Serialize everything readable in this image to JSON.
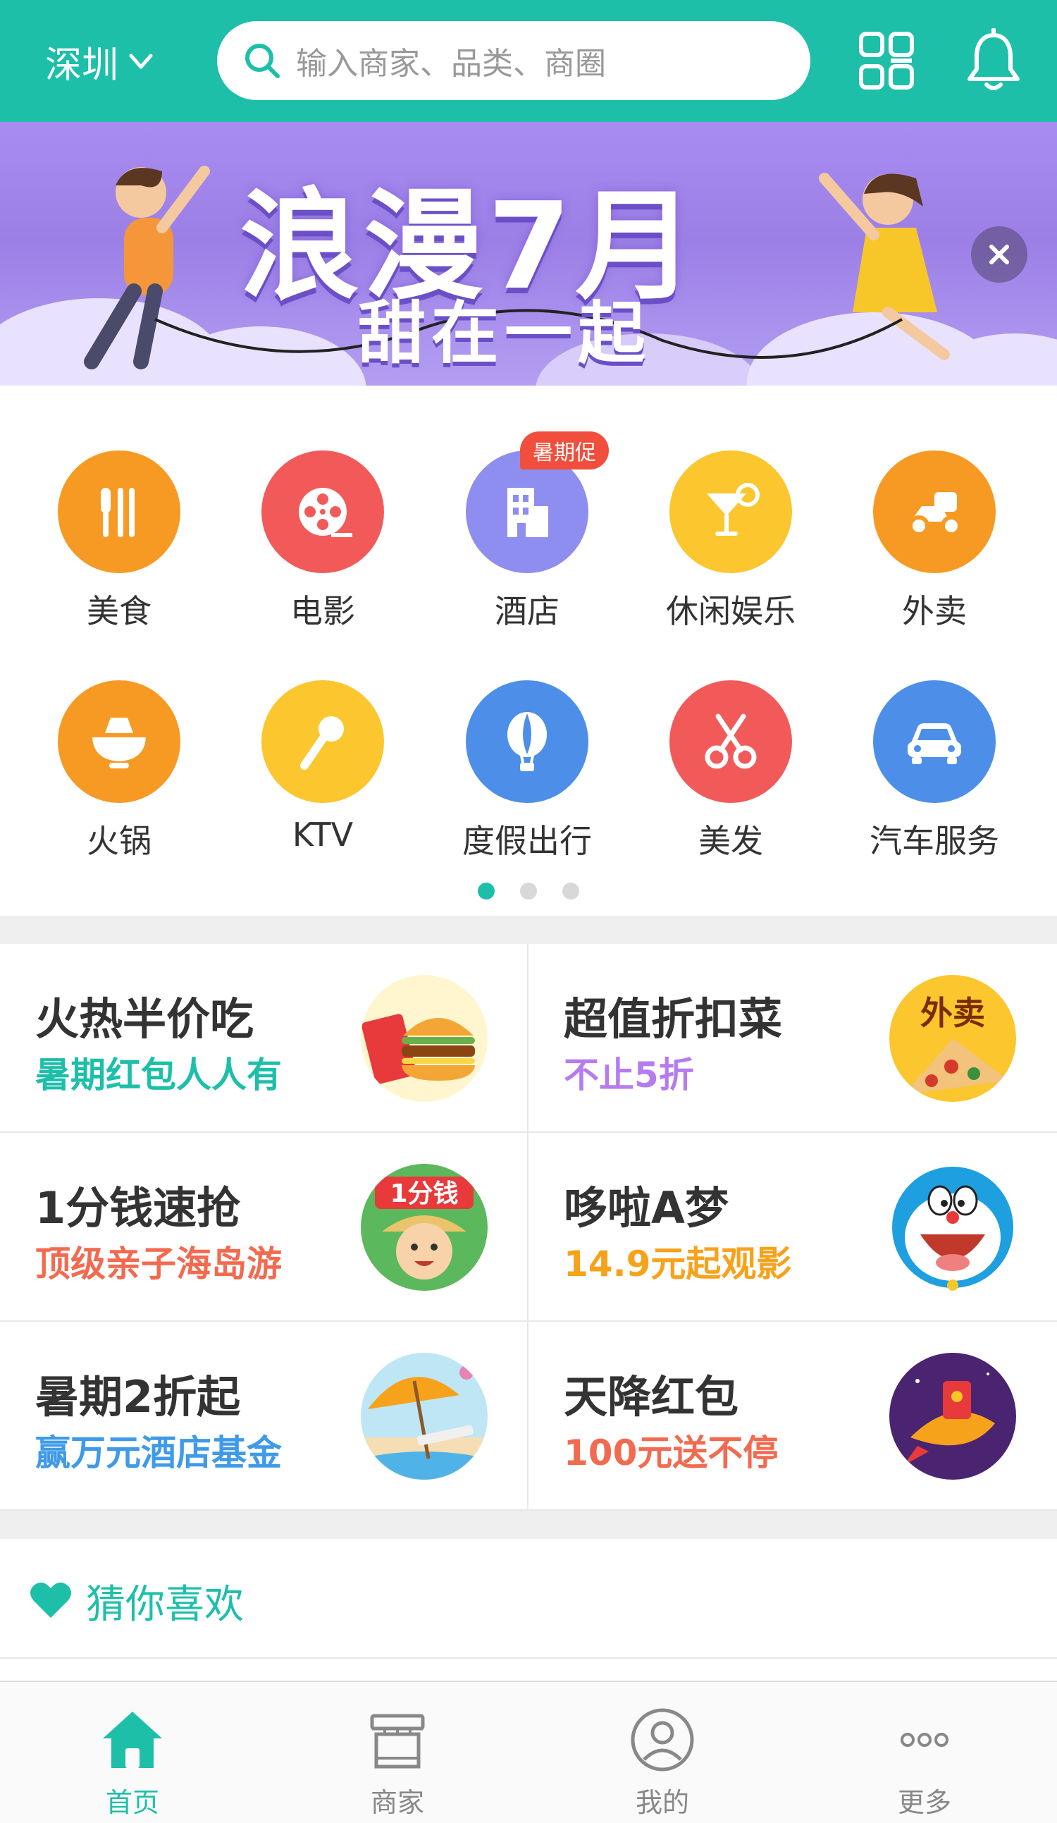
{
  "header": {
    "city": "深圳",
    "search_placeholder": "输入商家、品类、商圈",
    "icons": [
      "chevron-down-icon",
      "search-icon",
      "qr-scan-icon",
      "bell-icon"
    ]
  },
  "banner": {
    "title": "浪漫7月",
    "subtitle": "甜在一起"
  },
  "categories": [
    {
      "label": "美食",
      "color": "#f79a24",
      "icon": "cutlery-icon"
    },
    {
      "label": "电影",
      "color": "#f25a5a",
      "icon": "film-reel-icon"
    },
    {
      "label": "酒店",
      "color": "#8e8ef0",
      "icon": "hotel-icon",
      "badge": "暑期促"
    },
    {
      "label": "休闲娱乐",
      "color": "#fbc62e",
      "icon": "cocktail-icon"
    },
    {
      "label": "外卖",
      "color": "#f79a24",
      "icon": "scooter-icon"
    },
    {
      "label": "火锅",
      "color": "#f79a24",
      "icon": "hotpot-icon"
    },
    {
      "label": "KTV",
      "color": "#fbc62e",
      "icon": "microphone-icon"
    },
    {
      "label": "度假出行",
      "color": "#4d8fe8",
      "icon": "balloon-icon"
    },
    {
      "label": "美发",
      "color": "#f25a5a",
      "icon": "scissors-icon"
    },
    {
      "label": "汽车服务",
      "color": "#4d8fe8",
      "icon": "car-icon"
    }
  ],
  "promos": [
    {
      "title": "火热半价吃",
      "subtitle": "暑期红包人人有",
      "subtitle_color": "#1dbfa9"
    },
    {
      "title": "超值折扣菜",
      "subtitle": "不止5折",
      "subtitle_color": "#b57cf0",
      "image_text": "外卖"
    },
    {
      "title": "1分钱速抢",
      "subtitle": "顶级亲子海岛游",
      "subtitle_color": "#f26a4f",
      "image_text": "1分钱"
    },
    {
      "title": "哆啦A梦",
      "subtitle": "14.9元起观影",
      "subtitle_color": "#f7a21b"
    },
    {
      "title": "暑期2折起",
      "subtitle": "赢万元酒店基金",
      "subtitle_color": "#3f9ae8"
    },
    {
      "title": "天降红包",
      "subtitle": "100元送不停",
      "subtitle_color": "#f26a4f"
    }
  ],
  "guess": {
    "label": "猜你喜欢"
  },
  "tabbar": [
    {
      "label": "首页",
      "icon": "home-icon",
      "active": true
    },
    {
      "label": "商家",
      "icon": "store-icon",
      "active": false
    },
    {
      "label": "我的",
      "icon": "user-icon",
      "active": false
    },
    {
      "label": "更多",
      "icon": "more-icon",
      "active": false
    }
  ],
  "colors": {
    "brand": "#1dbfa9"
  }
}
